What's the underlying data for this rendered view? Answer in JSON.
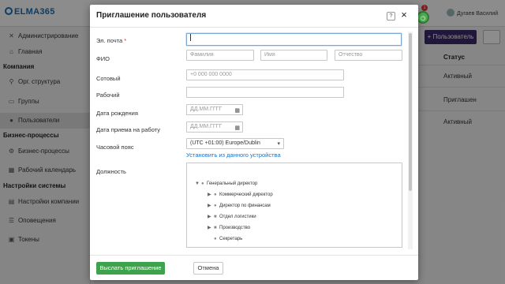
{
  "app": {
    "logo": "ELMA365",
    "user_name": "Дугаев Василий",
    "badge_a": "1",
    "badge_b": "1"
  },
  "sidebar": {
    "items": [
      {
        "label": "Администрирование",
        "icon": "wrench-icon"
      },
      {
        "label": "Главная",
        "icon": "home-icon"
      }
    ],
    "sections": [
      {
        "title": "Компания",
        "items": [
          {
            "label": "Орг. структура",
            "icon": "org-icon"
          },
          {
            "label": "Группы",
            "icon": "folder-icon"
          },
          {
            "label": "Пользователи",
            "icon": "user-icon"
          }
        ]
      },
      {
        "title": "Бизнес-процессы",
        "items": [
          {
            "label": "Бизнес-процессы",
            "icon": "gear-icon"
          },
          {
            "label": "Рабочий календарь",
            "icon": "calendar-icon"
          }
        ]
      },
      {
        "title": "Настройки системы",
        "items": [
          {
            "label": "Настройки компании",
            "icon": "settings-icon"
          },
          {
            "label": "Оповещения",
            "icon": "list-icon"
          },
          {
            "label": "Токены",
            "icon": "token-icon"
          }
        ]
      }
    ]
  },
  "main": {
    "add_user_button": "+ Пользователь",
    "status_header": "Статус",
    "statuses": [
      "Активный",
      "Приглашен",
      "Активный"
    ]
  },
  "dialog": {
    "title": "Приглашение пользователя",
    "help": "?",
    "close": "×",
    "fields": {
      "email_label": "Эл. почта",
      "email_required": "*",
      "fio_label": "ФИО",
      "surname_placeholder": "Фамилия",
      "name_placeholder": "Имя",
      "patronymic_placeholder": "Отчество",
      "mobile_label": "Сотовый",
      "mobile_placeholder": "+0 000 000 0000",
      "work_label": "Рабочий",
      "birth_label": "Дата рождения",
      "birth_placeholder": "ДД.ММ.ГГГГ",
      "hire_label": "Дата приема на работу",
      "hire_placeholder": "ДД.ММ.ГГГГ",
      "timezone_label": "Часовой пояс",
      "timezone_value": "(UTC +01:00) Europe/Dublin",
      "timezone_link": "Установить из данного устройства",
      "position_label": "Должность"
    },
    "tree": [
      {
        "label": "Генеральный директор",
        "level": 0,
        "toggle": "▼"
      },
      {
        "label": "Коммерческий директор",
        "level": 1,
        "toggle": "▶"
      },
      {
        "label": "Директор по финансам",
        "level": 1,
        "toggle": "▶"
      },
      {
        "label": "Отдел логистики",
        "level": 1,
        "toggle": "▶"
      },
      {
        "label": "Производство",
        "level": 1,
        "toggle": "▶"
      },
      {
        "label": "Секретарь",
        "level": 1,
        "toggle": ""
      }
    ],
    "send_button": "Выслать приглашение",
    "cancel_button": "Отмена"
  },
  "colors": {
    "accent": "#1a73c9",
    "send": "#3fa34d",
    "add_button": "#3b2b6b",
    "required": "#d32f2f"
  }
}
